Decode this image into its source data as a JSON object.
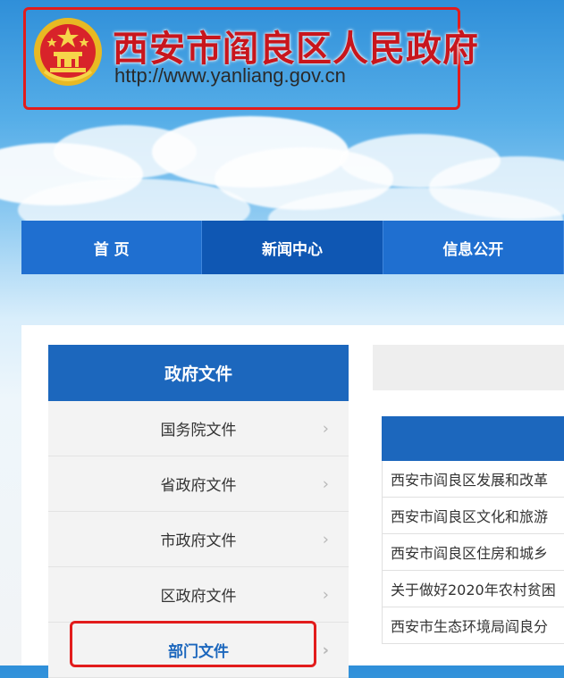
{
  "header": {
    "title": "西安市阎良区人民政府",
    "url": "http://www.yanliang.gov.cn",
    "emblem_icon": "national-emblem-icon"
  },
  "nav": {
    "items": [
      {
        "label": "首 页"
      },
      {
        "label": "新闻中心"
      },
      {
        "label": "信息公开"
      }
    ],
    "active_index": 1
  },
  "sidebar": {
    "title": "政府文件",
    "items": [
      {
        "label": "国务院文件"
      },
      {
        "label": "省政府文件"
      },
      {
        "label": "市政府文件"
      },
      {
        "label": "区政府文件"
      },
      {
        "label": "部门文件"
      }
    ],
    "chevron": "›"
  },
  "news": {
    "items": [
      {
        "title": "西安市阎良区发展和改革"
      },
      {
        "title": "西安市阎良区文化和旅游"
      },
      {
        "title": "西安市阎良区住房和城乡"
      },
      {
        "title": "关于做好2020年农村贫困"
      },
      {
        "title": "西安市生态环境局阎良分"
      }
    ]
  },
  "colors": {
    "brand_red": "#c8161d",
    "nav_blue": "#1f6fd0",
    "panel_blue": "#1c67bd",
    "highlight_red": "#e21c1c"
  }
}
